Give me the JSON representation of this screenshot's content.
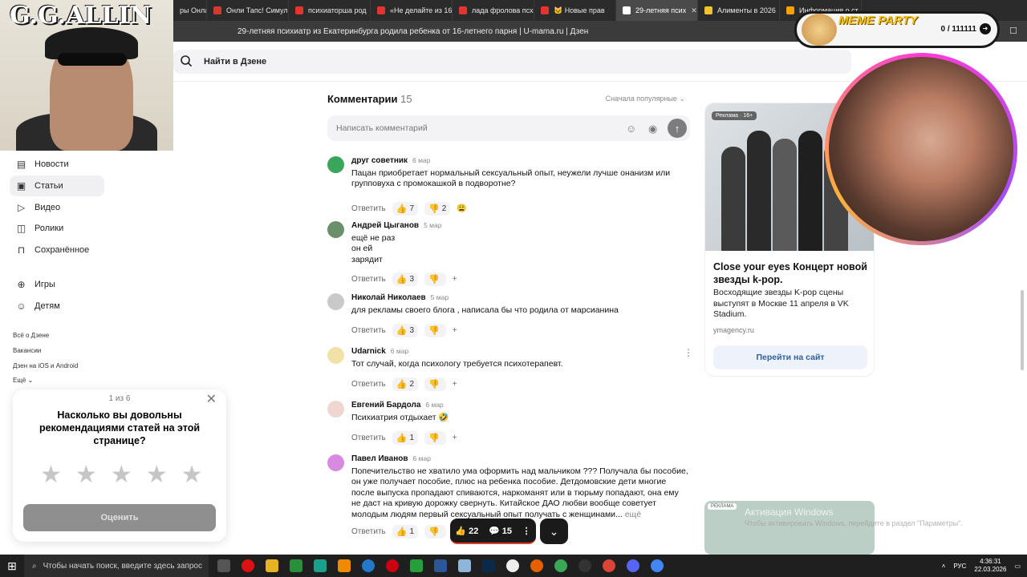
{
  "tabs": [
    {
      "title": "ры Онла",
      "color": "#6b6b6b"
    },
    {
      "title": "Онли Тапс! Симул",
      "color": "#d43b2f"
    },
    {
      "title": "психиаторша род",
      "color": "#e3342f"
    },
    {
      "title": "«Не делайте из 16",
      "color": "#e3342f"
    },
    {
      "title": "лада фролова псх",
      "color": "#e3342f"
    },
    {
      "title": "🐱 Новые прав",
      "color": "#e3342f"
    },
    {
      "title": "29-летняя псих",
      "color": "#ffffff",
      "active": true
    },
    {
      "title": "Алименты в 2026",
      "color": "#f2c230"
    },
    {
      "title": "Информация о ст",
      "color": "#f2a300"
    }
  ],
  "address": {
    "title": "29-летняя психиатр из Екатеринбурга родила ребенка от 16-летнего парня | U-mama.ru | Дзен"
  },
  "search": {
    "placeholder": "Найти в Дзене"
  },
  "webcam_left": {
    "label": "G.G.ALLIN"
  },
  "sidebar": {
    "items": [
      {
        "label": "Новости",
        "icon": "news-icon"
      },
      {
        "label": "Статьи",
        "icon": "articles-icon",
        "active": true
      },
      {
        "label": "Видео",
        "icon": "video-icon"
      },
      {
        "label": "Ролики",
        "icon": "shorts-icon"
      },
      {
        "label": "Сохранённое",
        "icon": "bookmark-icon"
      },
      {
        "label": "Игры",
        "icon": "gamepad-icon"
      },
      {
        "label": "Детям",
        "icon": "kids-icon"
      }
    ],
    "links": [
      "Всё о Дзене",
      "Вакансии",
      "Дзен на iOS и Android",
      "Ещё"
    ]
  },
  "rating_popup": {
    "counter": "1 из 6",
    "question": "Насколько вы довольны рекомендациями статей на этой странице?",
    "button": "Оценить"
  },
  "comments": {
    "title": "Комментарии",
    "count": "15",
    "sort": "Сначала популярные",
    "input_placeholder": "Написать комментарий",
    "reply_label": "Ответить",
    "items": [
      {
        "author": "друг советник",
        "date": "6 мар",
        "text": "Пацан приобретает нормальный сексуальный опыт, неужели лучше онанизм или групповуха с промокашкой в подворотне?",
        "likes": "7",
        "dislikes": "2",
        "extra": "😩"
      },
      {
        "author": "Андрей Цыганов",
        "date": "5 мар",
        "text": "ещё не раз\nон ей\nзарядит",
        "likes": "3",
        "dislikes": "",
        "extra": "+"
      },
      {
        "author": "Николай Николаев",
        "date": "5 мар",
        "text": "для рекламы своего блога , написала бы что родила от марсианина",
        "likes": "3",
        "dislikes": "",
        "extra": "+"
      },
      {
        "author": "Udarnick",
        "date": "6 мар",
        "text": "Тот случай, когда психологу требуется психотерапевт.",
        "likes": "2",
        "dislikes": "",
        "extra": "+"
      },
      {
        "author": "Евгений Бардола",
        "date": "6 мар",
        "text": "Психиатрия отдыхает 🤣",
        "likes": "1",
        "dislikes": "",
        "extra": "+"
      },
      {
        "author": "Павел Иванов",
        "date": "6 мар",
        "text": "Попечительство не хватило ума оформить над мальчиком ??? Получала бы пособие, он уже получает пособие, плюс на ребенка пособие. Детдомовские дети многие после выпуска пропадают спиваются, наркоманят или в тюрьму попадают, она ему не даст на кривую дорожку свернуть. Китайское ДАО любви вообще советует молодым людям первый сексуальный опыт получать с женщинами...",
        "more": "ещё",
        "likes": "1",
        "dislikes": "",
        "extra": ""
      }
    ]
  },
  "floatbar": {
    "likes": "22",
    "comments": "15"
  },
  "ad": {
    "tag": "Реклама · 16+",
    "title": "Close your eyes Концерт новой звезды k-pop.",
    "desc": "Восходящие звезды K-pop сцены выступят в Москве 11 апреля в VK Stadium.",
    "domain": "ymagency.ru",
    "button": "Перейти на сайт"
  },
  "ad2": {
    "tag": "РЕКЛАМА"
  },
  "windows_activation": {
    "title": "Активация Windows",
    "text": "Чтобы активировать Windows, перейдите в раздел \"Параметры\"."
  },
  "meme_party": {
    "title": "MEME PARTY",
    "counter": "0 / 111111"
  },
  "taskbar": {
    "search_placeholder": "Чтобы начать поиск, введите здесь запрос",
    "lang": "РУС",
    "time": "4:36:31",
    "date": "22.03.2026"
  }
}
